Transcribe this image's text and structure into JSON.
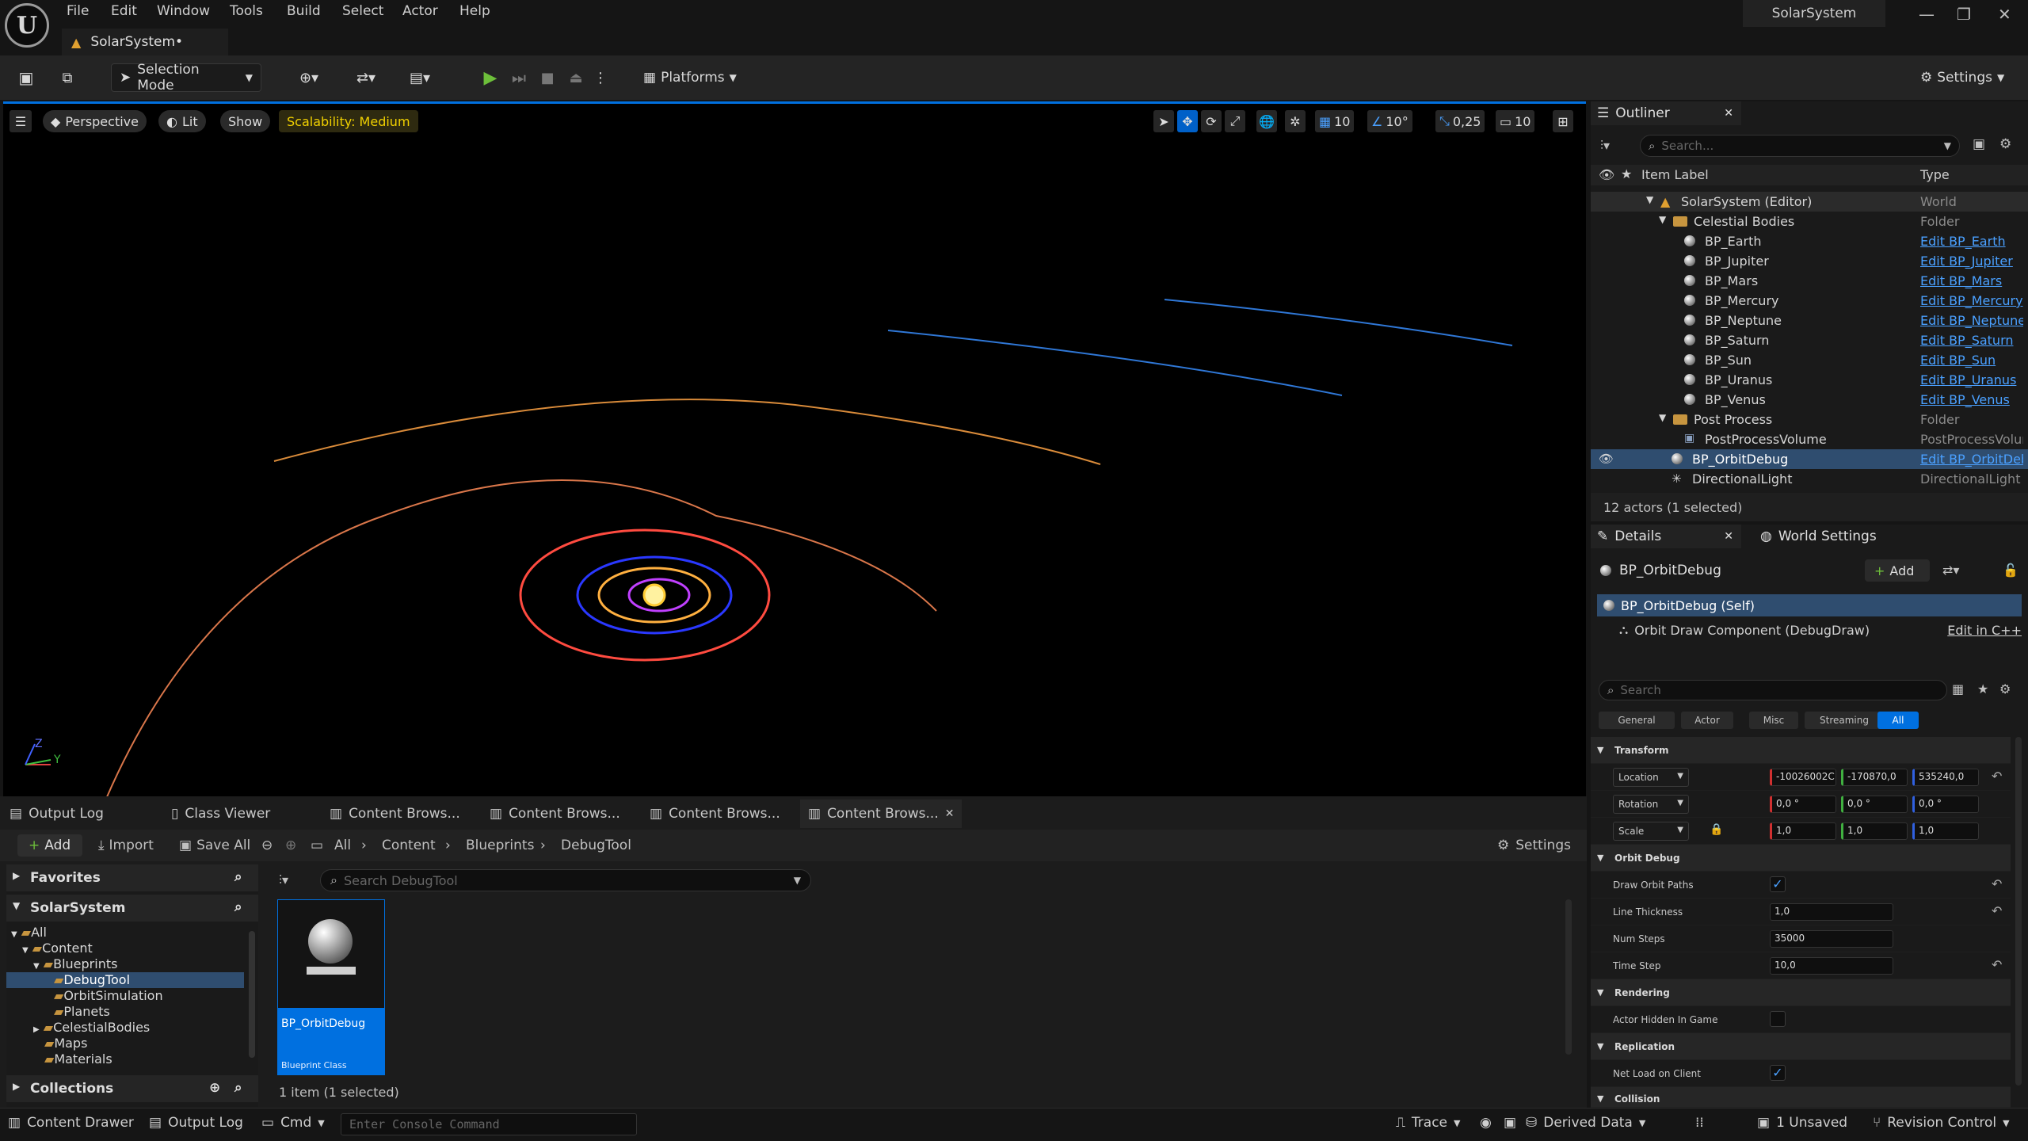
{
  "menu": [
    "File",
    "Edit",
    "Window",
    "Tools",
    "Build",
    "Select",
    "Actor",
    "Help"
  ],
  "map_tab": "SolarSystem•",
  "app_title": "SolarSystem",
  "toolbar": {
    "selection_mode": "Selection Mode",
    "platforms": "Platforms",
    "settings": "Settings"
  },
  "viewport": {
    "perspective": "Perspective",
    "lit": "Lit",
    "show": "Show",
    "scalability": "Scalability: Medium",
    "grid_snap": "10",
    "rot_snap": "10°",
    "scale_snap": "0,25",
    "cam_speed": "10",
    "axis_y": "Y",
    "axis_z": "Z"
  },
  "outliner": {
    "tab": "Outliner",
    "search_placeholder": "Search...",
    "col_label": "Item Label",
    "col_type": "Type",
    "rows": [
      {
        "label": "SolarSystem (Editor)",
        "type": "World"
      },
      {
        "label": "Celestial Bodies",
        "type": "Folder"
      },
      {
        "label": "BP_Earth",
        "type": "Edit BP_Earth"
      },
      {
        "label": "BP_Jupiter",
        "type": "Edit BP_Jupiter"
      },
      {
        "label": "BP_Mars",
        "type": "Edit BP_Mars"
      },
      {
        "label": "BP_Mercury",
        "type": "Edit BP_Mercury"
      },
      {
        "label": "BP_Neptune",
        "type": "Edit BP_Neptune"
      },
      {
        "label": "BP_Saturn",
        "type": "Edit BP_Saturn"
      },
      {
        "label": "BP_Sun",
        "type": "Edit BP_Sun"
      },
      {
        "label": "BP_Uranus",
        "type": "Edit BP_Uranus"
      },
      {
        "label": "BP_Venus",
        "type": "Edit BP_Venus"
      },
      {
        "label": "Post Process",
        "type": "Folder"
      },
      {
        "label": "PostProcessVolume",
        "type": "PostProcessVolume"
      },
      {
        "label": "BP_OrbitDebug",
        "type": "Edit BP_OrbitDebug"
      },
      {
        "label": "DirectionalLight",
        "type": "DirectionalLight"
      }
    ],
    "footer": "12 actors (1 selected)"
  },
  "details": {
    "tab": "Details",
    "world_settings": "World Settings",
    "actor_name": "BP_OrbitDebug",
    "add_label": "Add",
    "self_row": "BP_OrbitDebug (Self)",
    "component": "Orbit Draw Component (DebugDraw)",
    "edit_cpp": "Edit in C++",
    "search_placeholder": "Search",
    "filters": [
      "General",
      "Actor",
      "Misc",
      "Streaming",
      "All"
    ],
    "transform": {
      "section": "Transform",
      "location_label": "Location",
      "rotation_label": "Rotation",
      "scale_label": "Scale",
      "location": [
        "-10026002C",
        "-170870,0",
        "535240,0"
      ],
      "rotation": [
        "0,0 °",
        "0,0 °",
        "0,0 °"
      ],
      "scale": [
        "1,0",
        "1,0",
        "1,0"
      ]
    },
    "orbit": {
      "section": "Orbit Debug",
      "draw_paths": "Draw Orbit Paths",
      "line_thickness_label": "Line Thickness",
      "line_thickness": "1,0",
      "num_steps_label": "Num Steps",
      "num_steps": "35000",
      "time_step_label": "Time Step",
      "time_step": "10,0"
    },
    "rendering": {
      "section": "Rendering",
      "hidden": "Actor Hidden In Game"
    },
    "replication": {
      "section": "Replication",
      "net_load": "Net Load on Client"
    },
    "collision": {
      "section": "Collision"
    }
  },
  "bottom": {
    "tabs": [
      "Output Log",
      "Class Viewer",
      "Content Brows...",
      "Content Brows...",
      "Content Brows...",
      "Content Brows..."
    ],
    "add": "Add",
    "import": "Import",
    "save_all": "Save All",
    "breadcrumb": [
      "All",
      "Content",
      "Blueprints",
      "DebugTool"
    ],
    "settings": "Settings",
    "favorites": "Favorites",
    "project": "SolarSystem",
    "search_placeholder": "Search DebugTool",
    "tree": [
      "All",
      "Content",
      "Blueprints",
      "DebugTool",
      "OrbitSimulation",
      "Planets",
      "CelestialBodies",
      "Maps",
      "Materials"
    ],
    "collections": "Collections",
    "asset_name": "BP_OrbitDebug",
    "asset_type": "Blueprint Class",
    "count": "1 item (1 selected)"
  },
  "status": {
    "content_drawer": "Content Drawer",
    "output_log": "Output Log",
    "cmd": "Cmd",
    "console_placeholder": "Enter Console Command",
    "trace": "Trace",
    "derived_data": "Derived Data",
    "unsaved": "1 Unsaved",
    "revision": "Revision Control"
  },
  "colors": {
    "accent": "#0070e0",
    "selection": "#2f4d6f",
    "link": "#4aa0ff",
    "folder": "#c7953f",
    "play": "#6dbf3a"
  }
}
